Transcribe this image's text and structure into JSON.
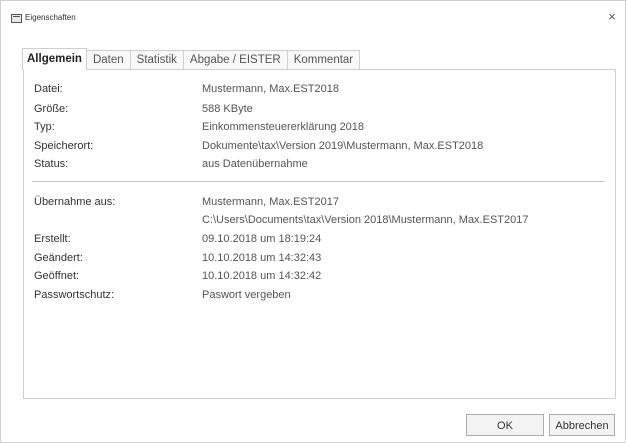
{
  "window": {
    "title": "Eigenschaften",
    "close_glyph": "×"
  },
  "tabs": [
    {
      "label": "Allgemein",
      "active": true
    },
    {
      "label": "Daten",
      "active": false
    },
    {
      "label": "Statistik",
      "active": false
    },
    {
      "label": "Abgabe / EISTER",
      "active": false
    },
    {
      "label": "Kommentar",
      "active": false
    }
  ],
  "general": [
    {
      "label": "Datei:",
      "value": "Mustermann, Max.EST2018"
    },
    {
      "label": "Größe:",
      "value": "588 KByte"
    },
    {
      "label": "Typ:",
      "value": "Einkommensteuererklärung 2018"
    },
    {
      "label": "Speicherort:",
      "value": "Dokumente\\tax\\Version 2019\\Mustermann, Max.EST2018"
    },
    {
      "label": "Status:",
      "value": "aus Datenübernahme"
    }
  ],
  "history": {
    "takeover_label": "Übernahme aus:",
    "takeover_value": "Mustermann, Max.EST2017",
    "takeover_path": "C:\\Users\\Documents\\tax\\Version 2018\\Mustermann, Max.EST2017",
    "rows": [
      {
        "label": "Erstellt:",
        "value": "09.10.2018 um 18:19:24"
      },
      {
        "label": "Geändert:",
        "value": "10.10.2018 um 14:32:43"
      },
      {
        "label": "Geöffnet:",
        "value": "10.10.2018 um 14:32:42"
      },
      {
        "label": "Passwortschutz:",
        "value": "Paswort vergeben"
      }
    ]
  },
  "buttons": {
    "ok": "OK",
    "cancel": "Abbrechen"
  }
}
